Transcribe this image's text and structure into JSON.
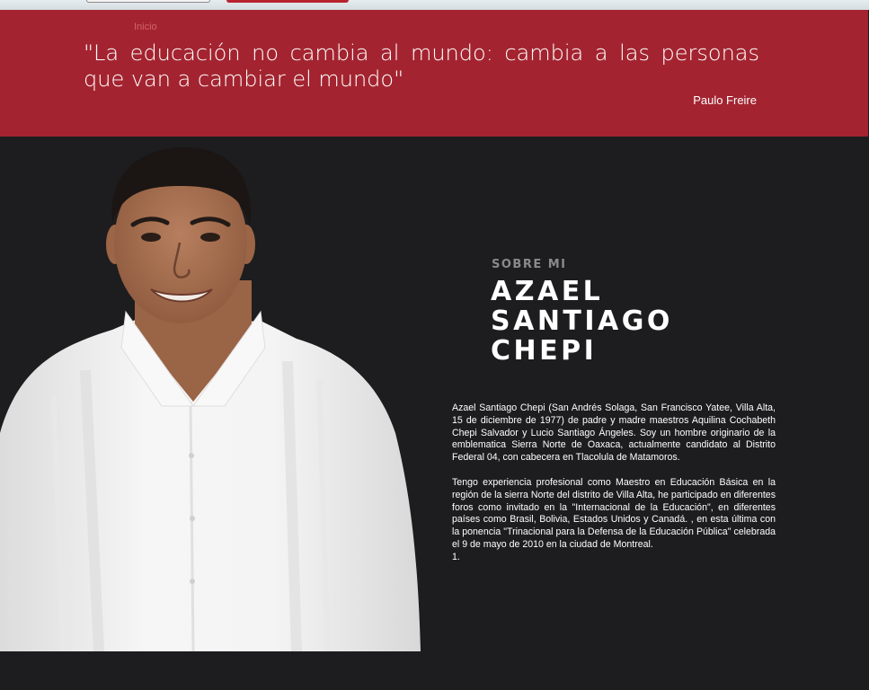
{
  "breadcrumb": {
    "home_label": "Inicio"
  },
  "quote": {
    "text": "\"La educación no cambia al mundo: cambia a las personas que van a cambiar el mundo\"",
    "author": "Paulo Freire"
  },
  "about": {
    "eyebrow": "SOBRE MI",
    "name_lines": [
      "AZAEL",
      "SANTIAGO",
      "CHEPI"
    ],
    "paragraphs": [
      "Azael Santiago Chepi (San Andrés Solaga, San Francisco Yatee, Villa Alta, 15 de diciembre de 1977) de padre y madre maestros Aquilina Cochabeth Chepi Salvador y Lucio Santiago Ángeles. Soy un hombre originario de la emblematica Sierra Norte de Oaxaca, actualmente candidato al Distrito Federal 04, con cabecera en Tlacolula de Matamoros.",
      "Tengo experiencia profesional como Maestro en Educación Básica en la región de la sierra Norte del distrito de Villa Alta, he participado en diferentes foros como invitado en la \"Internacional de la Educación\", en diferentes países como Brasil, Bolivia, Estados Unidos y Canadá. , en esta última con la ponencia \"Trinacional para la Defensa de la Educación Pública\" celebrada el 9 de mayo de 2010 en la ciudad de Montreal."
    ],
    "tail": "1."
  },
  "colors": {
    "brand_red": "#a32430",
    "dark_bg": "#1d1d1f",
    "muted_gray": "#8a8a8c"
  }
}
